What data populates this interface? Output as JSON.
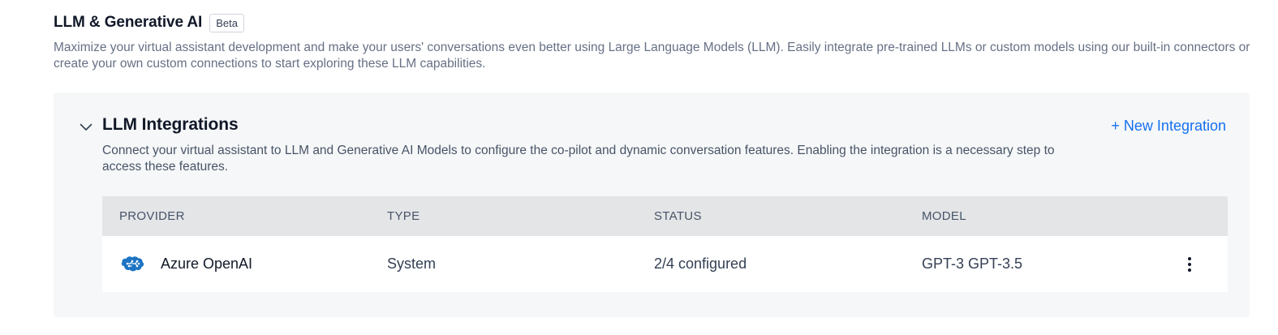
{
  "page": {
    "title": "LLM & Generative AI",
    "badge": "Beta",
    "description": "Maximize your virtual assistant development and make your users' conversations even better using Large Language Models (LLM). Easily integrate pre-trained LLMs or custom models using our built-in connectors or create your own custom connections to start exploring these LLM capabilities."
  },
  "section": {
    "title": "LLM Integrations",
    "new_integration_label": "+ New Integration",
    "description": "Connect your virtual assistant to LLM and Generative AI Models to configure the co-pilot and dynamic conversation features. Enabling the integration is a necessary step to access these features.",
    "toggle_icon": "chevron-down-icon"
  },
  "table": {
    "columns": [
      "PROVIDER",
      "TYPE",
      "STATUS",
      "MODEL"
    ],
    "rows": [
      {
        "provider": "Azure OpenAI",
        "provider_icon": "azure-openai-brain-icon",
        "type": "System",
        "status": "2/4 configured",
        "model": "GPT-3 GPT-3.5",
        "menu_icon": "more-vertical-icon"
      }
    ]
  },
  "colors": {
    "accent": "#1570ef",
    "section_bg": "#f6f7f8",
    "table_header_bg": "#e4e5e7",
    "provider_icon": "#1d73c4"
  }
}
